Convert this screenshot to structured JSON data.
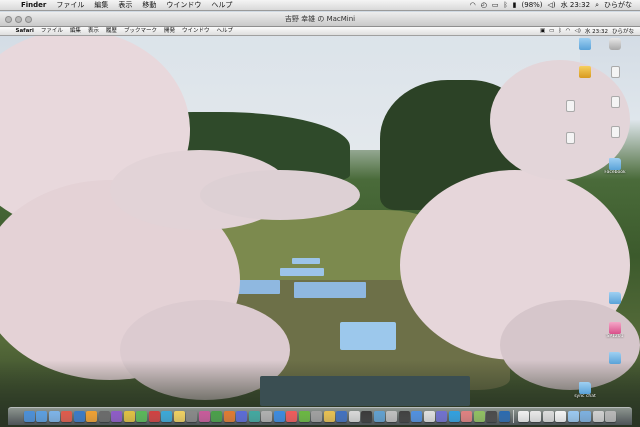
{
  "host_menubar": {
    "apple": "",
    "app_name": "Finder",
    "items": [
      "ファイル",
      "編集",
      "表示",
      "移動",
      "ウインドウ",
      "ヘルプ"
    ],
    "status": {
      "battery": "(98%)",
      "clock": "水 23:32",
      "user": "ひらがな"
    }
  },
  "window": {
    "title": "吉野 幸雄 の MacMini"
  },
  "remote_menubar": {
    "apple": "",
    "app_name": "Safari",
    "items": [
      "ファイル",
      "編集",
      "表示",
      "履歴",
      "ブックマーク",
      "開発",
      "ウインドウ",
      "ヘルプ"
    ],
    "status": {
      "clock": "水 23:32",
      "user": "ひらがな"
    }
  },
  "desktop_icons": [
    {
      "name": "folder-icon",
      "type": "folder",
      "label": ""
    },
    {
      "name": "drive-icon",
      "type": "disk",
      "label": ""
    },
    {
      "name": "app-icon",
      "type": "app",
      "label": ""
    },
    {
      "name": "document-icon",
      "type": "doc",
      "label": ""
    },
    {
      "name": "document-icon",
      "type": "doc",
      "label": ""
    },
    {
      "name": "document-icon",
      "type": "doc",
      "label": ""
    },
    {
      "name": "document-icon",
      "type": "doc",
      "label": ""
    },
    {
      "name": "document-icon",
      "type": "doc",
      "label": ""
    },
    {
      "name": "folder-icon",
      "type": "folder",
      "label": "Facebook"
    },
    {
      "name": "folder-icon",
      "type": "folder",
      "label": ""
    },
    {
      "name": "pink-document-icon",
      "type": "pink",
      "label": "SP1201"
    },
    {
      "name": "folder-icon",
      "type": "folder",
      "label": ""
    },
    {
      "name": "folder-icon",
      "type": "folder",
      "label": "sync chat"
    }
  ],
  "dock": {
    "left_colors": [
      "#4a8fd8",
      "#5a9ee0",
      "#7cb3e8",
      "#e05a4a",
      "#3a7ac8",
      "#f0a030",
      "#6a6a6a",
      "#8e5ac8",
      "#e0c040",
      "#58b858",
      "#d04040",
      "#3aa8d8",
      "#f0d060",
      "#888888",
      "#c85a9a",
      "#48a048",
      "#e07a30",
      "#5a6ad8",
      "#40a8a0",
      "#b0b0b0",
      "#3a8ae0",
      "#f05a5a",
      "#6ab840",
      "#a0a0a0",
      "#e8c050",
      "#4070c0",
      "#d8d8d8",
      "#3a3a3a",
      "#60a0d0",
      "#c0c0c0",
      "#404040",
      "#5090e0",
      "#e0e0e0",
      "#7070d0",
      "#30a0e0",
      "#e08080",
      "#90c060",
      "#4a4a4a",
      "#2a6ab0"
    ],
    "right_colors": [
      "#f0f0f0",
      "#e8e8e8",
      "#dcdcdc",
      "#f4f4f4",
      "#9ac8f0",
      "#7cb0e0",
      "#d0d0d0",
      "#b8b8b8"
    ]
  }
}
